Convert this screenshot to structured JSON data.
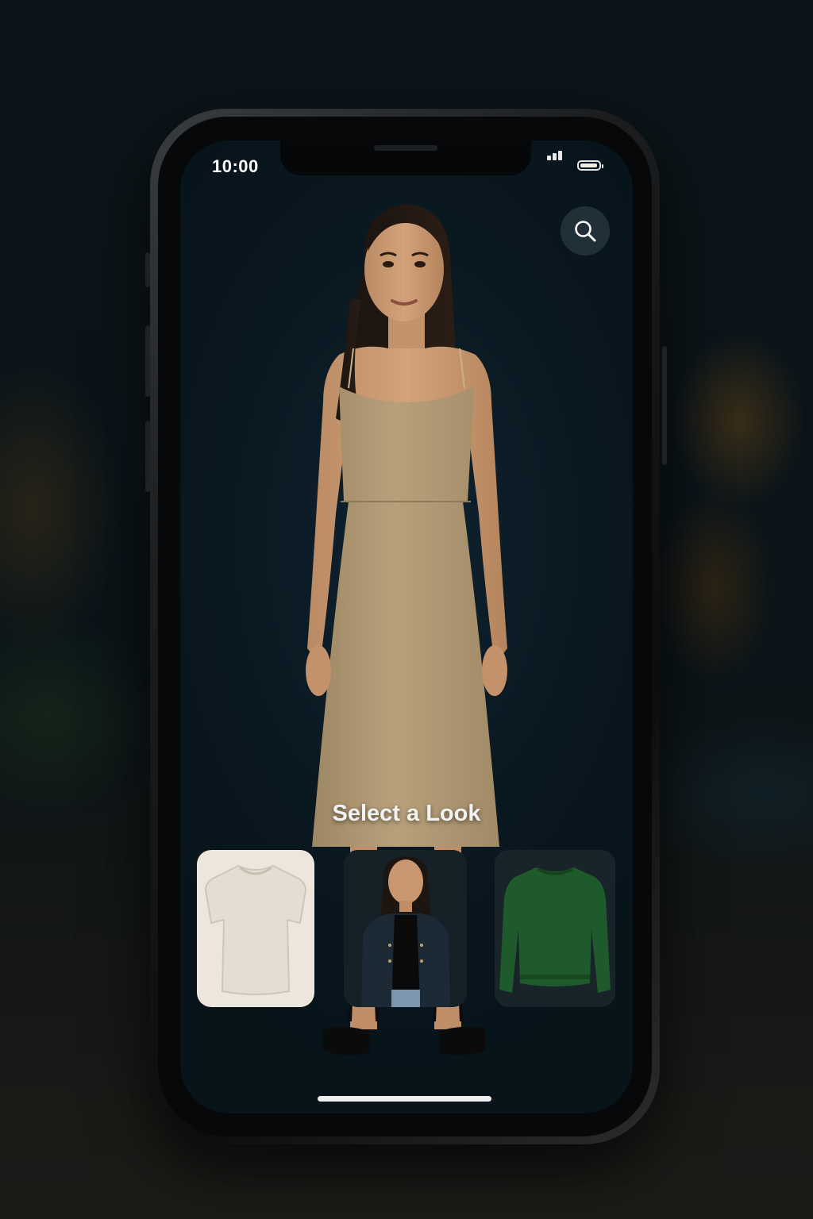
{
  "status_bar": {
    "time": "10:00"
  },
  "header": {
    "search_icon": "search-icon"
  },
  "main": {
    "cta_label": "Select a Look"
  },
  "looks": [
    {
      "name": "tee",
      "icon": "t-shirt",
      "color": "#e4ddd2"
    },
    {
      "name": "jacket-look",
      "icon": "model-denim-jacket",
      "color": "#1c2a36"
    },
    {
      "name": "sweater",
      "icon": "green-sweater",
      "color": "#1f5a2c"
    }
  ],
  "colors": {
    "screen_bg": "#0a1820",
    "dress": "#b39a77",
    "accent_text": "#f2f2f2"
  }
}
